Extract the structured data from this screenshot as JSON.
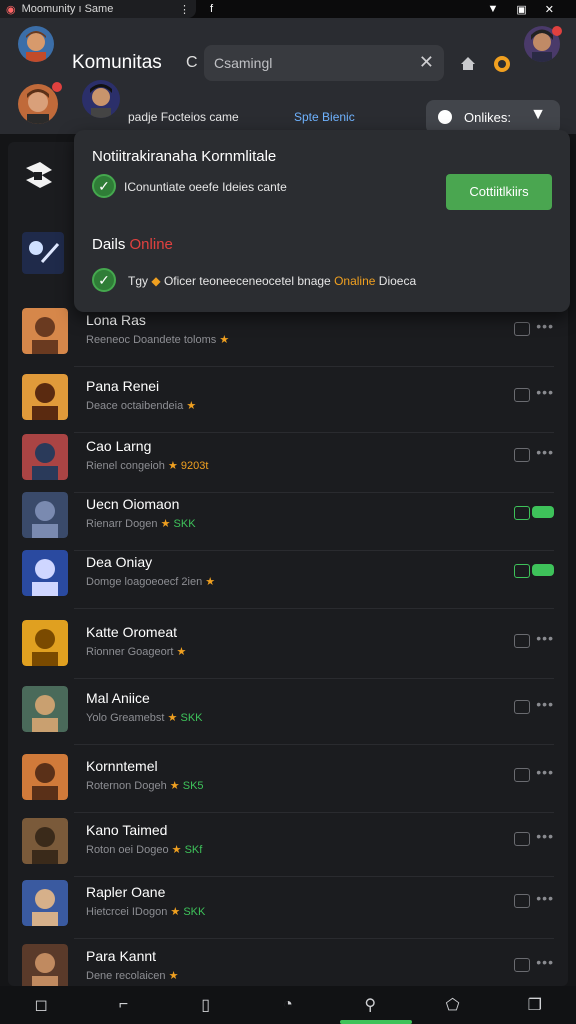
{
  "status": {
    "tab_title": "Moomunity ı Same",
    "icon_left": "f"
  },
  "header": {
    "title": "Komunitas",
    "title_suffix": "C",
    "search_value": "Csamingl",
    "row2_name": "padje Focteios came",
    "row2_extra": "Spte Bienic",
    "online_button": "Onlikes:"
  },
  "popup": {
    "title": "Notiitrakiranaha Kornmlitale",
    "line1": "IConuntiate oeefe Ideies cante",
    "confirm_label": "Cottiitlkiirs",
    "sub_label": "Dails",
    "sub_highlight": "Online",
    "line2_pre": "Tgy",
    "line2_mid": "Oficer teoneeceneocetel bnage",
    "line2_highlight": "Onaline",
    "line2_post": "Dioeca"
  },
  "items": [
    {
      "name": "Lona Ras",
      "sub": "Reeneoc Doandete toloms",
      "sub_tag": "",
      "badge": ""
    },
    {
      "name": "Pana Renei",
      "sub": "Deace octaibendeia",
      "sub_tag": "",
      "badge": ""
    },
    {
      "name": "Cao Larng",
      "sub": "Rienel congeioh",
      "sub_tag": "9203t",
      "badge": ""
    },
    {
      "name": "Uecn Oiomaon",
      "sub": "Rienarr Dogen",
      "sub_tag": "SKK",
      "badge": "on"
    },
    {
      "name": "Dea Oniay",
      "sub": "Domge loagoeoecf 2ien",
      "sub_tag": "",
      "badge": "on"
    },
    {
      "name": "Katte Oromeat",
      "sub": "Rionner Goageort",
      "sub_tag": "",
      "badge": ""
    },
    {
      "name": "Mal Aniice",
      "sub": "Yolo Greamebst",
      "sub_tag": "SKK",
      "badge": ""
    },
    {
      "name": "Kornntemel",
      "sub": "Roternon Dogeh",
      "sub_tag": "SK5",
      "badge": ""
    },
    {
      "name": "Kano Taimed",
      "sub": "Roton oei Dogeo",
      "sub_tag": "SKf",
      "badge": ""
    },
    {
      "name": "Rapler Oane",
      "sub": "Hietcrcei IDogon",
      "sub_tag": "SKK",
      "badge": ""
    },
    {
      "name": "Para Kannt",
      "sub": "Dene recolaicen",
      "sub_tag": "",
      "badge": ""
    }
  ],
  "colors": {
    "accent_green": "#3ec25a",
    "highlight_orange": "#f0a020",
    "online_red": "#e0413f"
  }
}
